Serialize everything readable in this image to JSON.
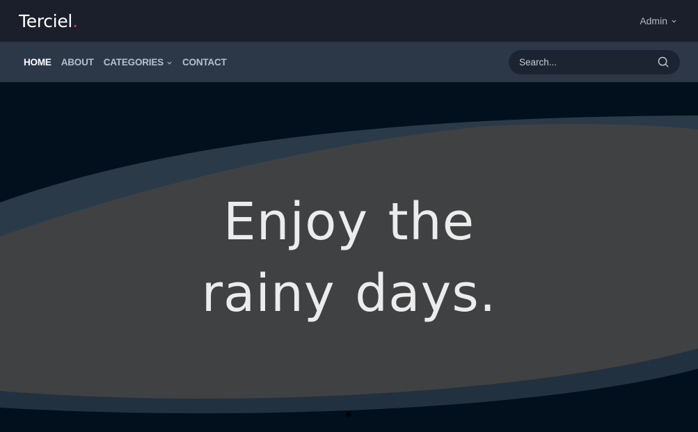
{
  "header": {
    "brand": "Terciel",
    "brand_dot": ".",
    "user_menu_label": "Admin"
  },
  "nav": {
    "items": [
      {
        "label": "HOME",
        "active": true
      },
      {
        "label": "ABOUT",
        "active": false
      },
      {
        "label": "CATEGORIES",
        "active": false,
        "dropdown": true
      },
      {
        "label": "CONTACT",
        "active": false
      }
    ]
  },
  "search": {
    "placeholder": "Search...",
    "icon": "search-icon"
  },
  "hero": {
    "line1": "Enjoy the",
    "line2": "rainy days.",
    "slide_count": 1,
    "active_slide": 1
  },
  "colors": {
    "topbar_bg": "#1b1f2b",
    "navbar_bg": "#2c3848",
    "hero_bg": "#01101c",
    "hero_shape": "#404142",
    "brand_accent": "#e83d4b"
  }
}
